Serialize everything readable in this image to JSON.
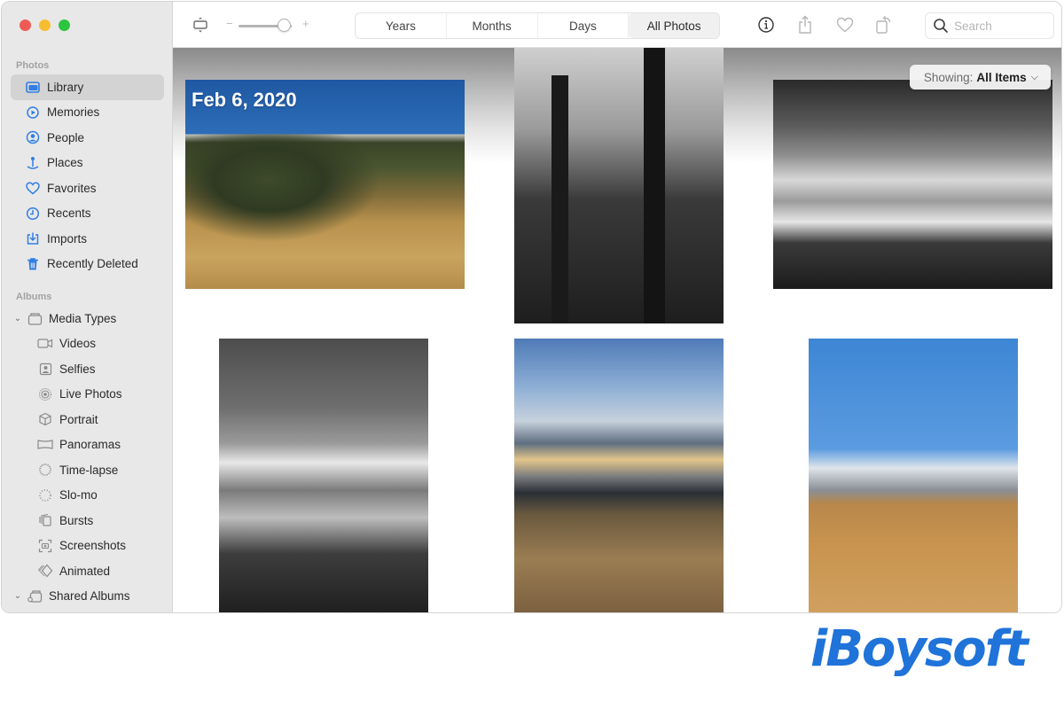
{
  "window": {
    "traffic_lights": [
      "close",
      "minimize",
      "zoom"
    ]
  },
  "sidebar": {
    "sections": [
      {
        "title": "Photos",
        "items": [
          {
            "label": "Library",
            "icon": "library-icon",
            "active": true
          },
          {
            "label": "Memories",
            "icon": "memories-icon"
          },
          {
            "label": "People",
            "icon": "people-icon"
          },
          {
            "label": "Places",
            "icon": "places-icon"
          },
          {
            "label": "Favorites",
            "icon": "heart-icon"
          },
          {
            "label": "Recents",
            "icon": "clock-icon"
          },
          {
            "label": "Imports",
            "icon": "import-icon"
          },
          {
            "label": "Recently Deleted",
            "icon": "trash-icon"
          }
        ]
      },
      {
        "title": "Albums",
        "groups": [
          {
            "label": "Media Types",
            "icon": "folder-icon",
            "expanded": true,
            "items": [
              {
                "label": "Videos",
                "icon": "video-icon"
              },
              {
                "label": "Selfies",
                "icon": "selfie-icon"
              },
              {
                "label": "Live Photos",
                "icon": "live-photo-icon"
              },
              {
                "label": "Portrait",
                "icon": "cube-icon"
              },
              {
                "label": "Panoramas",
                "icon": "panorama-icon"
              },
              {
                "label": "Time-lapse",
                "icon": "timelapse-icon"
              },
              {
                "label": "Slo-mo",
                "icon": "slomo-icon"
              },
              {
                "label": "Bursts",
                "icon": "bursts-icon"
              },
              {
                "label": "Screenshots",
                "icon": "screenshot-icon"
              },
              {
                "label": "Animated",
                "icon": "animated-icon"
              }
            ]
          },
          {
            "label": "Shared Albums",
            "icon": "shared-albums-icon",
            "expanded": true
          }
        ]
      }
    ]
  },
  "toolbar": {
    "segments": [
      {
        "label": "Years"
      },
      {
        "label": "Months"
      },
      {
        "label": "Days"
      },
      {
        "label": "All Photos",
        "active": true
      }
    ],
    "zoom_minus": "−",
    "zoom_plus": "+",
    "zoom_level_fraction": 0.85,
    "search": {
      "placeholder": "Search",
      "value": ""
    }
  },
  "content": {
    "date_label": "Feb 6, 2020",
    "showing": {
      "prefix": "Showing:",
      "value": "All Items"
    },
    "photos": [
      {
        "description": "golden field with haystacks and pine trees under blue sky"
      },
      {
        "description": "black and white silhouetted plants and trees"
      },
      {
        "description": "black and white mountain landscape"
      },
      {
        "description": "black and white snowy mountain range with clouds"
      },
      {
        "description": "sunset over mountains with dry grass"
      },
      {
        "description": "snowy peak above golden grassland under blue sky"
      }
    ]
  },
  "watermark": {
    "text": "iBoysoft",
    "color": "#1f73d9"
  }
}
